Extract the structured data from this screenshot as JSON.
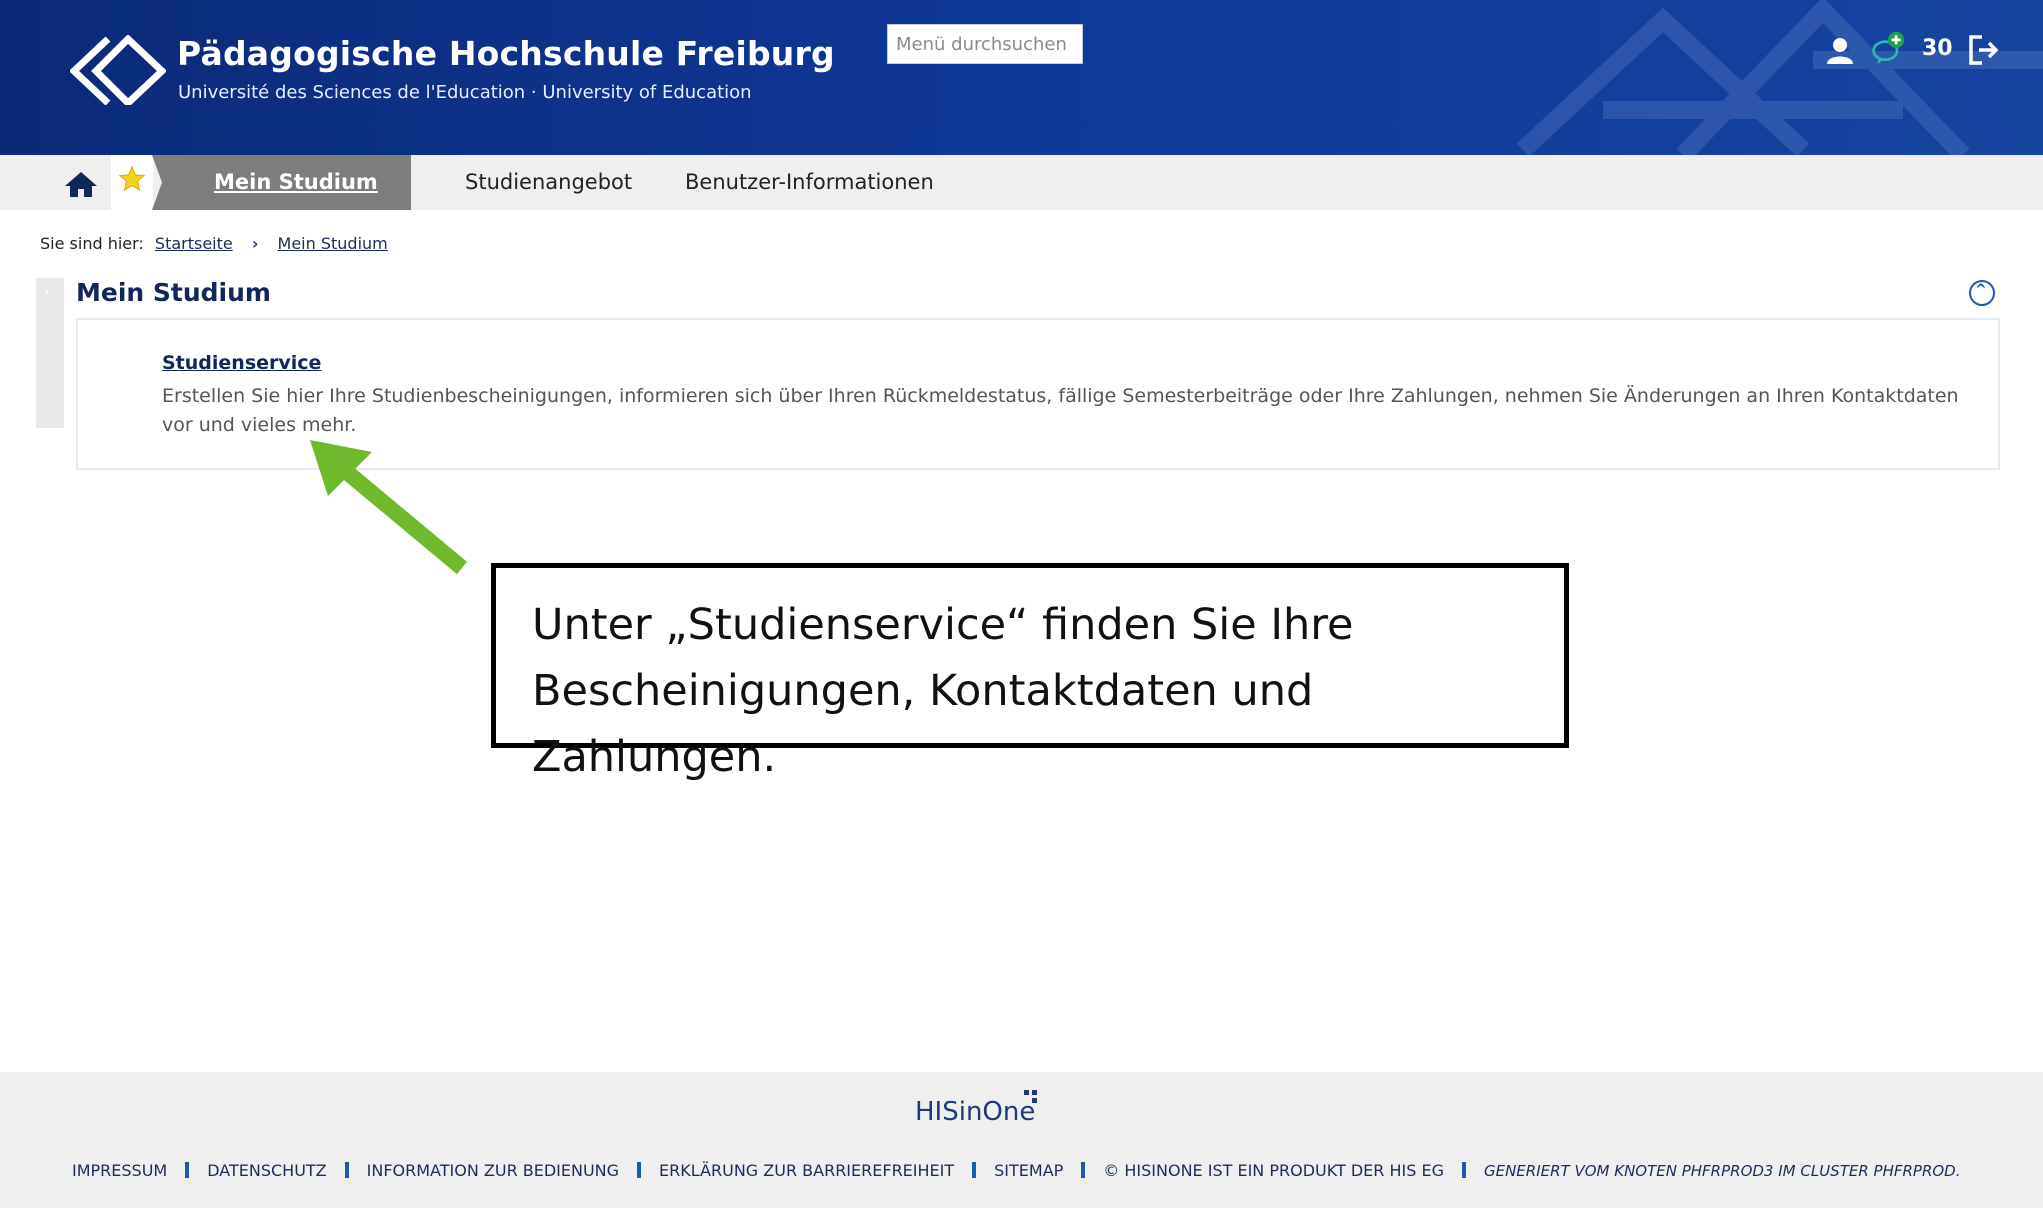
{
  "header": {
    "logo_title": "Pädagogische Hochschule Freiburg",
    "logo_subtitle": "Université des Sciences de l'Education · University of Education",
    "menu_search_placeholder": "Menü durchsuchen",
    "notification_count": "30",
    "icons": [
      "user-icon",
      "chat-add-icon",
      "logout-icon"
    ]
  },
  "nav": {
    "home_icon": "home-icon",
    "favorite_icon": "star-icon",
    "active_tab": "Mein Studium",
    "tabs": [
      "Studienangebot",
      "Benutzer-Informationen"
    ]
  },
  "breadcrumb": {
    "prefix": "Sie sind hier:",
    "items": [
      "Startseite",
      "Mein Studium"
    ]
  },
  "section": {
    "title": "Mein Studium",
    "collapse_icon": "chevron-up-circle-icon",
    "link_title": "Studienservice",
    "description": "Erstellen Sie hier Ihre Studienbescheinigungen, informieren sich über Ihren Rückmeldestatus, fällige Semesterbeiträge oder Ihre Zahlungen, nehmen Sie Änderungen an Ihren Kontaktdaten vor und vieles mehr."
  },
  "annotation": {
    "text": "Unter „Studienservice“ finden Sie Ihre Bescheinigungen, Kontaktdaten und Zahlungen.",
    "arrow_color": "#6fba2c"
  },
  "footer": {
    "logo_text": "HISinOne",
    "links": [
      "IMPRESSUM",
      "DATENSCHUTZ",
      "INFORMATION ZUR BEDIENUNG",
      "ERKLÄRUNG ZUR BARRIEREFREIHEIT",
      "SITEMAP",
      "© HISINONE IST EIN PRODUKT DER HIS EG"
    ],
    "generated": "GENERIERT VOM KNOTEN PHFRPROD3 IM CLUSTER PHFRPROD."
  },
  "colors": {
    "header_blue": "#0e3a9a",
    "nav_active": "#7d7d7d",
    "link_navy": "#10275b"
  }
}
